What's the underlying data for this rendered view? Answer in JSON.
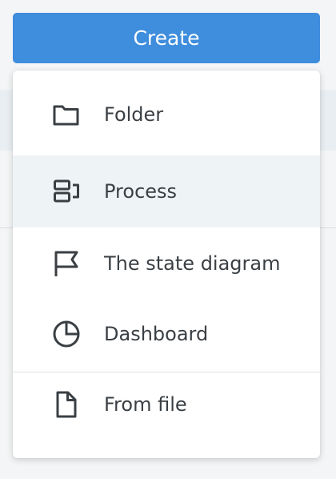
{
  "create_button": {
    "label": "Create"
  },
  "menu": {
    "items": [
      {
        "label": "Folder",
        "icon": "folder-icon"
      },
      {
        "label": "Process",
        "icon": "process-icon"
      },
      {
        "label": "The state diagram",
        "icon": "flag-icon"
      },
      {
        "label": "Dashboard",
        "icon": "pie-chart-icon"
      },
      {
        "label": "From file",
        "icon": "file-icon"
      }
    ],
    "highlighted_item": "Process"
  },
  "colors": {
    "accent": "#3f8ddd",
    "highlight": "#eef3f6",
    "text": "#3a3f44",
    "icon": "#3a3f44"
  }
}
